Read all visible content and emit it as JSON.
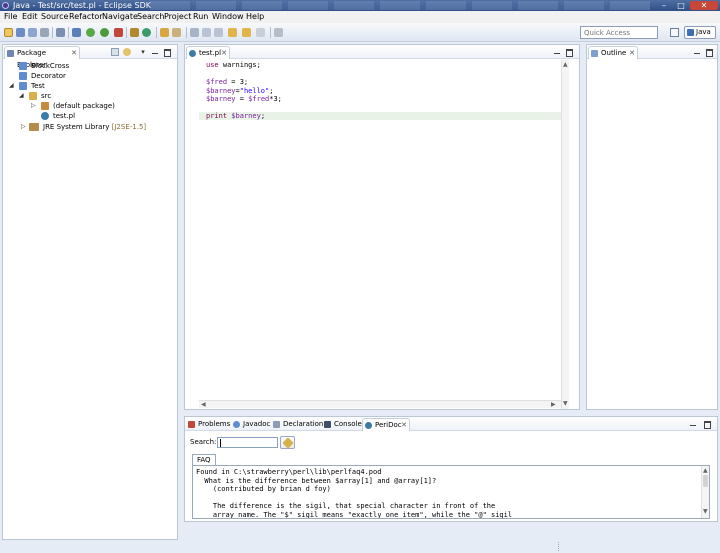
{
  "window": {
    "title": "Java - Test/src/test.pl - Eclipse SDK",
    "minimize_label": "–",
    "maximize_label": "□",
    "close_label": "✕"
  },
  "menu": [
    "File",
    "Edit",
    "Source",
    "Refactor",
    "Navigate",
    "Search",
    "Project",
    "Run",
    "Window",
    "Help"
  ],
  "toolbar": {
    "quick_access_placeholder": "Quick Access",
    "perspective_label": "Java"
  },
  "package_explorer": {
    "tab_label": "Package Explorer",
    "close_icon": "✕",
    "tree": {
      "blockcross": "BlockCross",
      "decorator": "Decorator",
      "test": "Test",
      "src": "src",
      "default_package": "(default package)",
      "test_pl": "test.pl",
      "jre_library": "JRE System Library",
      "jre_decoration": "[J2SE-1.5]"
    }
  },
  "editor": {
    "tab_label": "test.pl",
    "close_icon": "✕",
    "lines": [
      {
        "parts": [
          {
            "t": "use",
            "c": "kw"
          },
          {
            "t": " warnings;",
            "c": ""
          }
        ]
      },
      {
        "parts": []
      },
      {
        "parts": [
          {
            "t": "$fred",
            "c": "var"
          },
          {
            "t": " = 3;",
            "c": ""
          }
        ]
      },
      {
        "parts": [
          {
            "t": "$barney",
            "c": "var"
          },
          {
            "t": "=",
            "c": ""
          },
          {
            "t": "\"hello\"",
            "c": "str"
          },
          {
            "t": ";",
            "c": ""
          }
        ]
      },
      {
        "parts": [
          {
            "t": "$barney",
            "c": "var"
          },
          {
            "t": " = ",
            "c": ""
          },
          {
            "t": "$fred",
            "c": "var"
          },
          {
            "t": "*3;",
            "c": ""
          }
        ]
      },
      {
        "parts": []
      },
      {
        "parts": [
          {
            "t": "print",
            "c": "kw"
          },
          {
            "t": " ",
            "c": ""
          },
          {
            "t": "$barney",
            "c": "var"
          },
          {
            "t": ";",
            "c": ""
          }
        ]
      }
    ]
  },
  "outline": {
    "tab_label": "Outline",
    "close_icon": "✕"
  },
  "bottom": {
    "tabs": [
      "Problems",
      "Javadoc",
      "Declaration",
      "Console",
      "PeriDoc"
    ],
    "peridoc_close_icon": "✕",
    "search_label": "Search:",
    "search_value": "",
    "faq_tab": "FAQ",
    "faq_lines": [
      "Found in C:\\strawberry\\perl\\lib\\perlfaq4.pod",
      "  What is the difference between $array[1] and @array[1]?",
      "    (contributed by brian d foy)",
      "",
      "    The difference is the sigil, that special character in front of the",
      "    array name. The \"$\" sigil means \"exactly one item\", while the \"@\" sigil"
    ]
  },
  "colors": {
    "keyword": "#7f0055",
    "variable": "#7a1fa2",
    "string": "#2a00ff",
    "current_line": "#e8f2e6"
  }
}
